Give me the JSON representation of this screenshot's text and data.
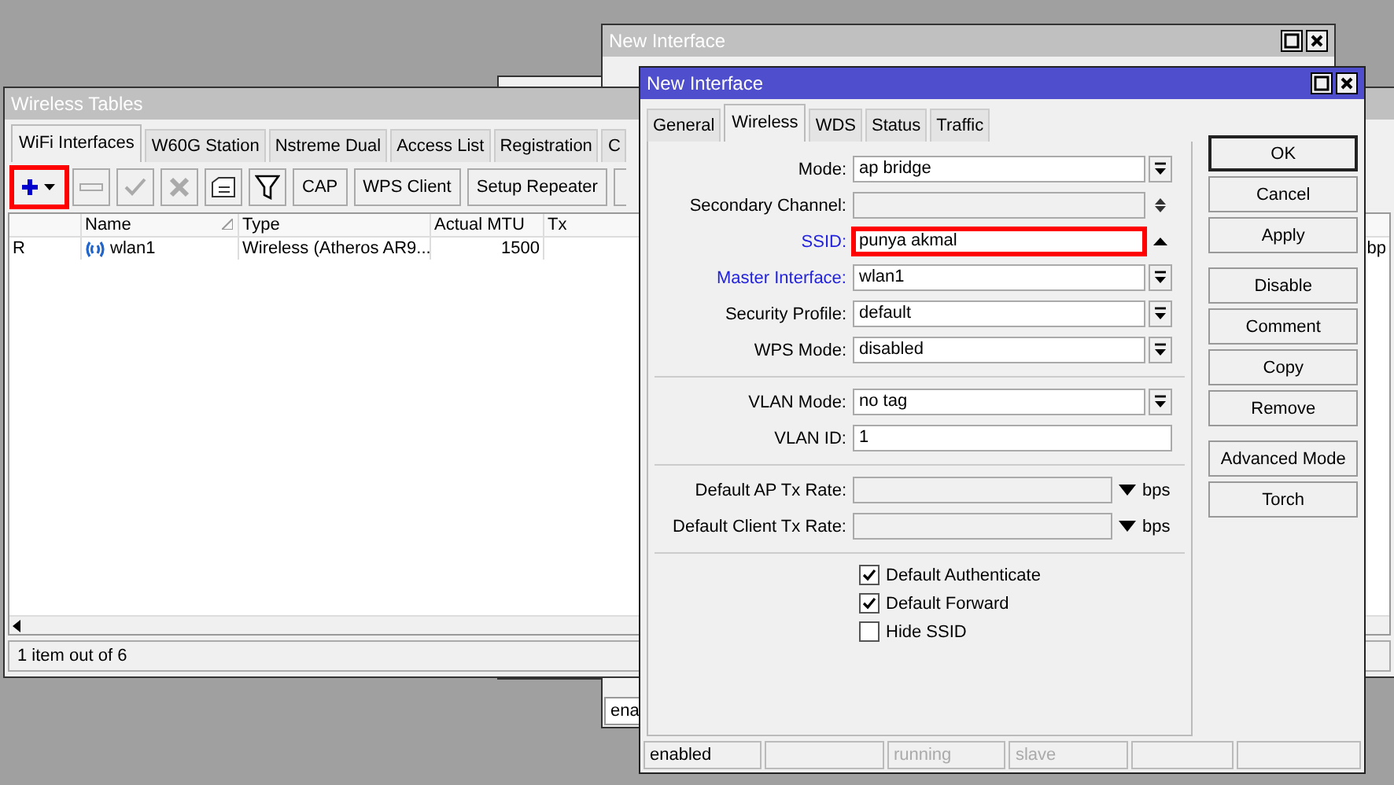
{
  "back_window": {
    "title": "New Interface",
    "status_text": "ena"
  },
  "wireless_tables": {
    "title": "Wireless Tables",
    "tabs": [
      {
        "label": "WiFi Interfaces",
        "selected": true
      },
      {
        "label": "W60G Station",
        "selected": false
      },
      {
        "label": "Nstreme Dual",
        "selected": false
      },
      {
        "label": "Access List",
        "selected": false
      },
      {
        "label": "Registration",
        "selected": false
      },
      {
        "label": "C",
        "selected": false
      }
    ],
    "toolbar": [
      {
        "kind": "add",
        "highlighted": true
      },
      {
        "kind": "remove",
        "disabled": true
      },
      {
        "kind": "enable",
        "disabled": true
      },
      {
        "kind": "disable",
        "disabled": true
      },
      {
        "kind": "comment",
        "disabled": false
      },
      {
        "kind": "filter"
      },
      {
        "kind": "text",
        "label": "CAP"
      },
      {
        "kind": "text",
        "label": "WPS Client"
      },
      {
        "kind": "text",
        "label": "Setup Repeater"
      },
      {
        "kind": "blank"
      }
    ],
    "table": {
      "columns": [
        {
          "sorted": false
        },
        {
          "label": "Name",
          "sorted": true
        },
        {
          "label": "Type"
        },
        {
          "label": "Actual MTU"
        },
        {
          "label": "Tx"
        }
      ],
      "rows": [
        {
          "flag": "R",
          "name": "wlan1",
          "type": "Wireless (Atheros AR9...",
          "actual_mtu": "1500",
          "column_6": "bp"
        }
      ]
    },
    "status_bar": "1 item out of 6"
  },
  "dialog": {
    "title": "New Interface",
    "tabs": [
      {
        "label": "General",
        "selected": false
      },
      {
        "label": "Wireless",
        "selected": true
      },
      {
        "label": "WDS",
        "selected": false
      },
      {
        "label": "Status",
        "selected": false
      },
      {
        "label": "Traffic",
        "selected": false
      }
    ],
    "field_groups": [
      [
        {
          "label": "Mode:",
          "value": "ap bridge",
          "kind": "dropdown",
          "link": false,
          "disabled": false,
          "highlighted": false
        },
        {
          "label": "Secondary Channel:",
          "kind": "updown",
          "link": false,
          "disabled": true,
          "highlighted": false
        },
        {
          "label": "SSID:",
          "value": "punya akmal",
          "kind": "up",
          "link": true,
          "disabled": false,
          "highlighted": true
        },
        {
          "label": "Master Interface:",
          "value": "wlan1",
          "kind": "dropdown",
          "link": true,
          "disabled": false,
          "highlighted": false
        },
        {
          "label": "Security Profile:",
          "value": "default",
          "kind": "dropdown",
          "link": false,
          "disabled": false,
          "highlighted": false
        },
        {
          "label": "WPS Mode:",
          "value": "disabled",
          "kind": "dropdown",
          "link": false,
          "disabled": false,
          "highlighted": false
        }
      ],
      [
        {
          "label": "VLAN Mode:",
          "value": "no tag",
          "kind": "dropdown",
          "link": false,
          "disabled": false,
          "highlighted": false
        },
        {
          "label": "VLAN ID:",
          "value": "1",
          "kind": "text",
          "link": false,
          "disabled": false,
          "highlighted": false
        }
      ],
      [
        {
          "label": "Default AP Tx Rate:",
          "kind": "rate",
          "unit": "bps",
          "link": false,
          "disabled": true,
          "highlighted": false
        },
        {
          "label": "Default Client Tx Rate:",
          "kind": "rate",
          "unit": "bps",
          "link": false,
          "disabled": true,
          "highlighted": false
        }
      ]
    ],
    "checkboxes": [
      {
        "label": "Default Authenticate",
        "checked": true
      },
      {
        "label": "Default Forward",
        "checked": true
      },
      {
        "label": "Hide SSID",
        "checked": false
      }
    ],
    "button_groups": [
      [
        {
          "label": "OK",
          "default": true
        },
        {
          "label": "Cancel",
          "default": false
        },
        {
          "label": "Apply",
          "default": false
        }
      ],
      [
        {
          "label": "Disable",
          "default": false
        },
        {
          "label": "Comment",
          "default": false
        },
        {
          "label": "Copy",
          "default": false
        },
        {
          "label": "Remove",
          "default": false
        }
      ],
      [
        {
          "label": "Advanced Mode",
          "default": false
        },
        {
          "label": "Torch",
          "default": false
        }
      ]
    ],
    "status_bar": [
      {
        "kind": "text",
        "text": "enabled",
        "active": true
      },
      {
        "kind": "empty"
      },
      {
        "kind": "text",
        "text": "running",
        "active": false
      },
      {
        "kind": "text",
        "text": "slave",
        "active": false
      },
      {
        "kind": "empty"
      },
      {
        "kind": "empty"
      }
    ]
  }
}
